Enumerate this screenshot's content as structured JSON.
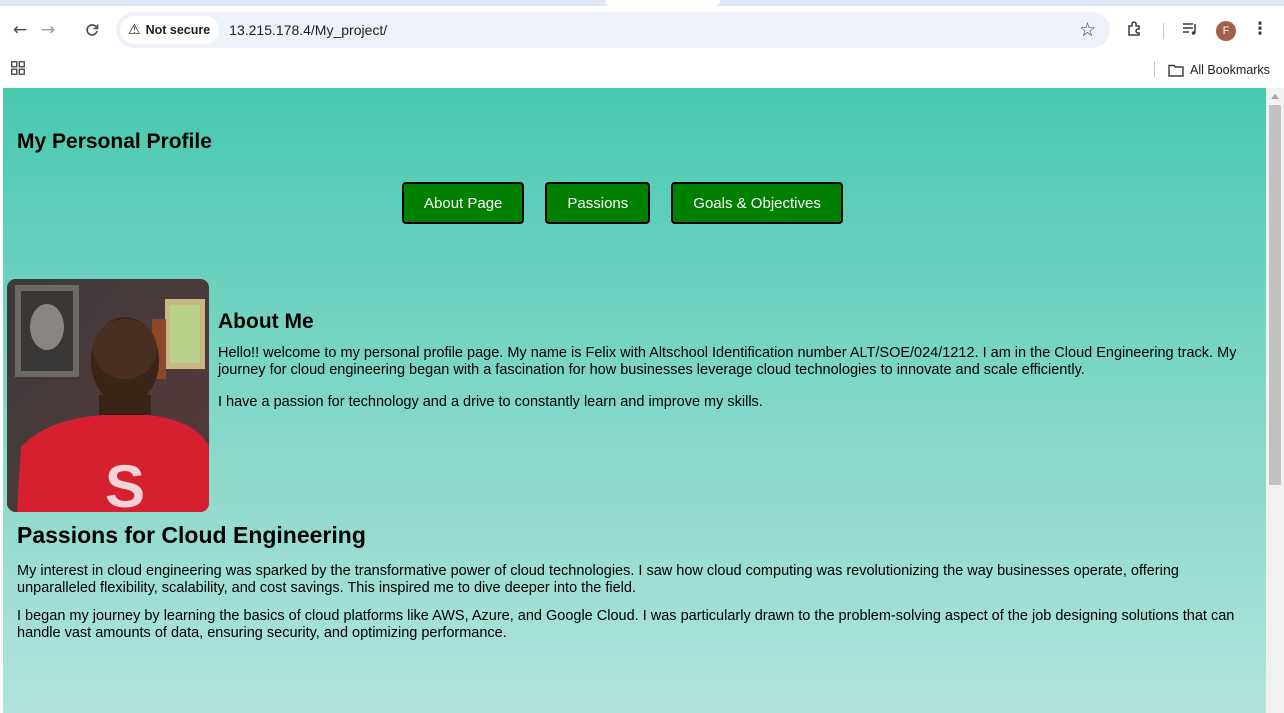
{
  "browser": {
    "security_label": "Not secure",
    "url": "13.215.178.4/My_project/",
    "profile_initial": "F",
    "bookmarks_label": "All Bookmarks"
  },
  "page": {
    "title": "My Personal Profile",
    "nav_buttons": [
      "About Page",
      "Passions",
      "Goals & Objectives"
    ],
    "about": {
      "heading": "About Me",
      "paragraphs": [
        "Hello!! welcome to my personal profile page. My name is Felix with Altschool Identification number ALT/SOE/024/1212. I am in the Cloud Engineering track. My journey for cloud engineering began with a fascination for how businesses leverage cloud technologies to innovate and scale efficiently.",
        "I have a passion for technology and a drive to constantly learn and improve my skills."
      ]
    },
    "passions": {
      "heading": "Passions for Cloud Engineering",
      "paragraphs": [
        "My interest in cloud engineering was sparked by the transformative power of cloud technologies. I saw how cloud computing was revolutionizing the way businesses operate, offering unparalleled flexibility, scalability, and cost savings. This inspired me to dive deeper into the field.",
        "I began my journey by learning the basics of cloud platforms like AWS, Azure, and Google Cloud. I was particularly drawn to the problem-solving aspect of the job designing solutions that can handle vast amounts of data, ensuring security, and optimizing performance."
      ]
    }
  },
  "colors": {
    "button_green": "#008000",
    "gradient_top": "#48c9b0",
    "gradient_bottom": "#b1e3dc"
  },
  "icons": [
    "back-arrow-icon",
    "forward-arrow-icon",
    "reload-icon",
    "warning-icon",
    "star-icon",
    "extensions-icon",
    "media-icon",
    "menu-icon",
    "apps-grid-icon",
    "folder-icon"
  ]
}
